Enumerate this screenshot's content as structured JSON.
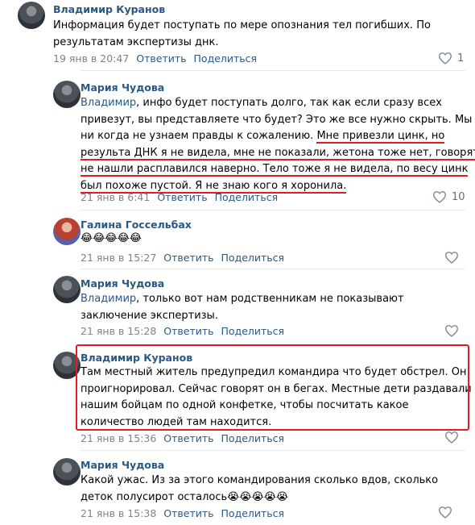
{
  "comments": [
    {
      "author": "Владимир Куранов",
      "lines": [
        "Информация будет поступать по мере опознания тел погибших. По",
        "результатам экспертизы днк."
      ],
      "date": "19 янв в 20:47",
      "reply": "Ответить",
      "share": "Поделиться",
      "likes": "1"
    },
    {
      "author": "Мария Чудова",
      "addressee": "Владимир",
      "line1_rest": ", инфо будет поступать долго, так как если сразу всех",
      "line2": "привезут, вы представляете что будет? Это же все нужно скрыть. Мы",
      "line3_plain": "ни когда не узнаем правды к сожалению.",
      "line3_ul": "Мне привезли цинк, но",
      "line4": "результа ДНК я не видела, мне не показали, жетона тоже нет, говорят",
      "line5": "не нашли расплавился наверно. Тело тоже я не видела, по весу цинк",
      "line6": "был похоже пустой. Я не знаю кого я хоронила.",
      "date": "21 янв в 6:41",
      "reply": "Ответить",
      "share": "Поделиться",
      "likes": "10"
    },
    {
      "author": "Галина Госсельбах",
      "emojis": "😂😂😂😂😂",
      "date": "21 янв в 15:27",
      "reply": "Ответить",
      "share": "Поделиться"
    },
    {
      "author": "Мария Чудова",
      "addressee": "Владимир",
      "line1_rest": ", только вот нам родственникам не показывают",
      "line2": "заключение экспертизы.",
      "date": "21 янв в 15:28",
      "reply": "Ответить",
      "share": "Поделиться"
    },
    {
      "author": "Владимир Куранов",
      "lines": [
        "Там местный житель предупредил командира что будет обстрел. Он",
        "проигнорировал. Сейчас говорят он в бегах. Местные дети раздавали",
        "нашим бойцам по одной конфетке, чтобы посчитать какое",
        "количество людей там находится."
      ],
      "date": "21 янв в 15:36",
      "reply": "Ответить",
      "share": "Поделиться"
    },
    {
      "author": "Мария Чудова",
      "line1": "Какой ужас. Из за этого командирования сколько вдов, сколько",
      "line2": "деток полусирот осталось",
      "emojis": "😭😭😭😭😭",
      "date": "21 янв в 15:38",
      "reply": "Ответить",
      "share": "Поделиться"
    }
  ],
  "colors": {
    "link": "#2a5885",
    "meta": "#828282",
    "highlight": "#e01c25"
  },
  "icons": {
    "like": "heart-icon"
  }
}
